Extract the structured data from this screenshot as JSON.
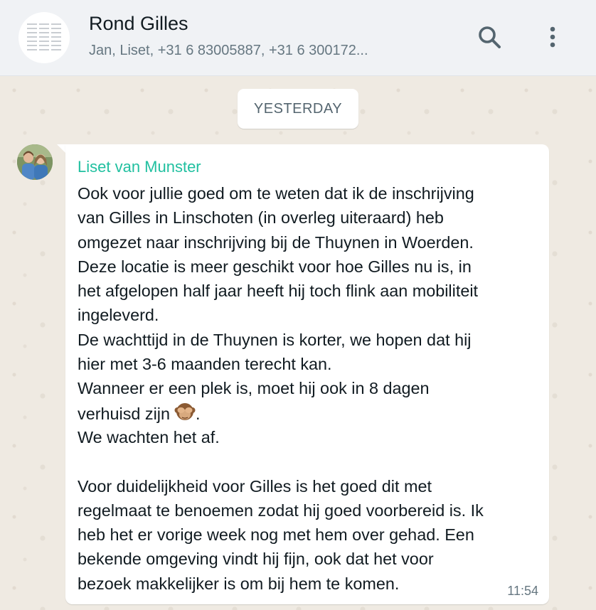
{
  "header": {
    "title": "Rond Gilles",
    "subtitle": "Jan, Liset, +31 6 83005887, +31 6 300172...",
    "search_icon": "search-icon",
    "menu_icon": "kebab-menu-icon"
  },
  "date_separator": "YESTERDAY",
  "message": {
    "sender": "Liset van Munster",
    "sender_color": "#21c0a0",
    "lines": [
      "Ook voor jullie goed om te weten dat ik de inschrijving",
      "van Gilles in Linschoten (in overleg uiteraard) heb",
      "omgezet naar inschrijving bij de Thuynen in Woerden.",
      "Deze locatie is meer geschikt voor hoe Gilles nu is, in",
      "het afgelopen half jaar heeft hij toch flink aan mobiliteit",
      "ingeleverd.",
      "De wachttijd in de Thuynen is korter, we hopen dat hij",
      "hier met 3-6 maanden terecht kan.",
      "Wanneer er een plek is, moet hij ook in 8 dagen",
      "verhuisd zijn",
      "We wachten het af.",
      "",
      "Voor duidelijkheid voor Gilles is het goed dit met",
      "regelmaat te benoemen zodat hij goed voorbereid is. Ik",
      "heb het er vorige week nog met hem over gehad. Een",
      "bekende omgeving vindt hij fijn, ook dat het voor",
      "bezoek makkelijker is om bij hem te komen."
    ],
    "emoji": "see-no-evil-monkey-icon",
    "emoji_suffix": ".",
    "time": "11:54"
  }
}
